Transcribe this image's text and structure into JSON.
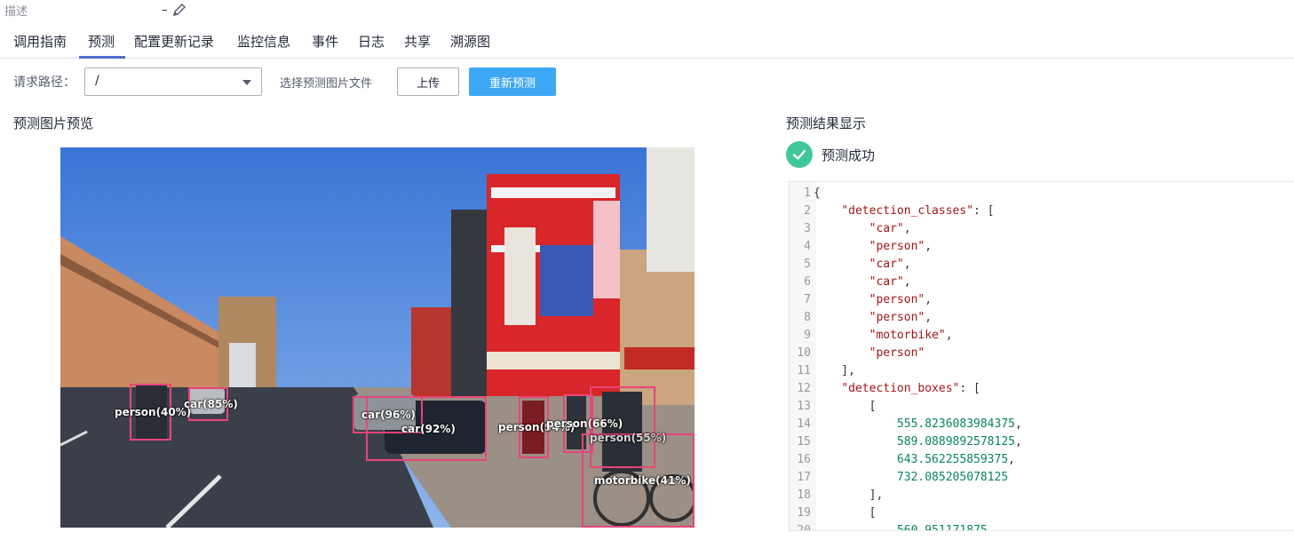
{
  "description": {
    "label": "描述",
    "value": "–",
    "edit_icon": "pencil-icon"
  },
  "tabs": [
    "调用指南",
    "预测",
    "配置更新记录",
    "监控信息",
    "事件",
    "日志",
    "共享",
    "溯源图"
  ],
  "active_tab": "预测",
  "request": {
    "path_label": "请求路径：",
    "path_value": "/",
    "choose_label": "选择预测图片文件",
    "upload_button": "上传",
    "repredict_button": "重新预测",
    "accent_color": "#3da8f5"
  },
  "preview": {
    "title": "预测图片预览",
    "detections": [
      {
        "label": "person(40%)"
      },
      {
        "label": "car(85%)"
      },
      {
        "label": "car(96%)"
      },
      {
        "label": "car(92%)"
      },
      {
        "label": "person(94%)"
      },
      {
        "label": "person(66%)"
      },
      {
        "label": "person(55%)"
      },
      {
        "label": "motorbike(41%)"
      }
    ],
    "box_color": "#e8457a"
  },
  "result": {
    "title": "预测结果显示",
    "status_icon": "check-circle-icon",
    "status_text": "预测成功",
    "status_color": "#3fc69a",
    "code_lines": [
      {
        "n": "1",
        "text": "{"
      },
      {
        "n": "2",
        "text": "    \"detection_classes\": ["
      },
      {
        "n": "3",
        "text": "        \"car\","
      },
      {
        "n": "4",
        "text": "        \"person\","
      },
      {
        "n": "5",
        "text": "        \"car\","
      },
      {
        "n": "6",
        "text": "        \"car\","
      },
      {
        "n": "7",
        "text": "        \"person\","
      },
      {
        "n": "8",
        "text": "        \"person\","
      },
      {
        "n": "9",
        "text": "        \"motorbike\","
      },
      {
        "n": "10",
        "text": "        \"person\""
      },
      {
        "n": "11",
        "text": "    ],"
      },
      {
        "n": "12",
        "text": "    \"detection_boxes\": ["
      },
      {
        "n": "13",
        "text": "        ["
      },
      {
        "n": "14",
        "text": "            555.8236083984375,"
      },
      {
        "n": "15",
        "text": "            589.0889892578125,"
      },
      {
        "n": "16",
        "text": "            643.562255859375,"
      },
      {
        "n": "17",
        "text": "            732.085205078125"
      },
      {
        "n": "18",
        "text": "        ],"
      },
      {
        "n": "19",
        "text": "        ["
      },
      {
        "n": "20",
        "text": "            560.951171875,"
      }
    ]
  }
}
